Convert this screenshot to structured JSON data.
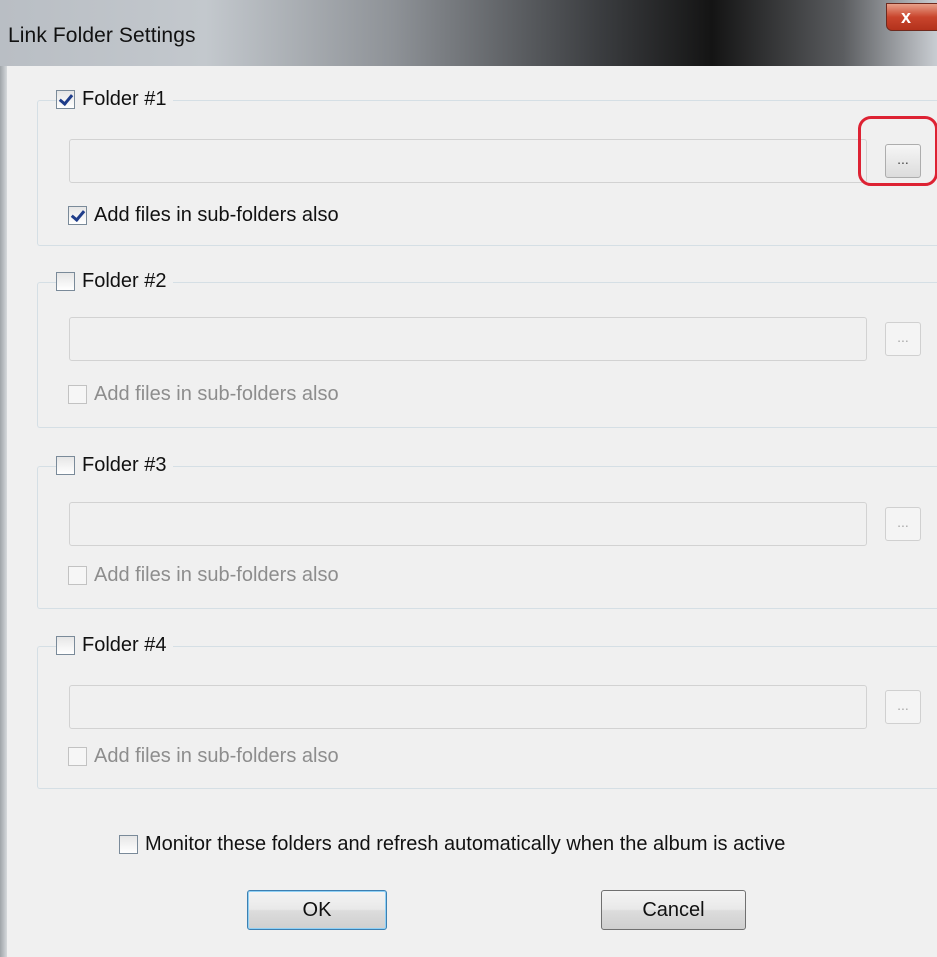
{
  "window": {
    "title": "Link Folder Settings",
    "close_glyph": "x"
  },
  "folders": [
    {
      "label": "Folder #1",
      "enabled": true,
      "path_value": "",
      "browse_label": "...",
      "subfolders_label": "Add files in sub-folders also",
      "subfolders_checked": true
    },
    {
      "label": "Folder #2",
      "enabled": false,
      "path_value": "",
      "browse_label": "...",
      "subfolders_label": "Add files in sub-folders also",
      "subfolders_checked": false
    },
    {
      "label": "Folder #3",
      "enabled": false,
      "path_value": "",
      "browse_label": "...",
      "subfolders_label": "Add files in sub-folders also",
      "subfolders_checked": false
    },
    {
      "label": "Folder #4",
      "enabled": false,
      "path_value": "",
      "browse_label": "...",
      "subfolders_label": "Add files in sub-folders also",
      "subfolders_checked": false
    }
  ],
  "monitor": {
    "label": "Monitor these folders and refresh automatically when the album is active",
    "checked": false
  },
  "buttons": {
    "ok_label": "OK",
    "cancel_label": "Cancel"
  },
  "colors": {
    "highlight_ring": "#dd2233",
    "check_mark": "#1f3d8a",
    "default_button_border": "#3c7fb1"
  }
}
